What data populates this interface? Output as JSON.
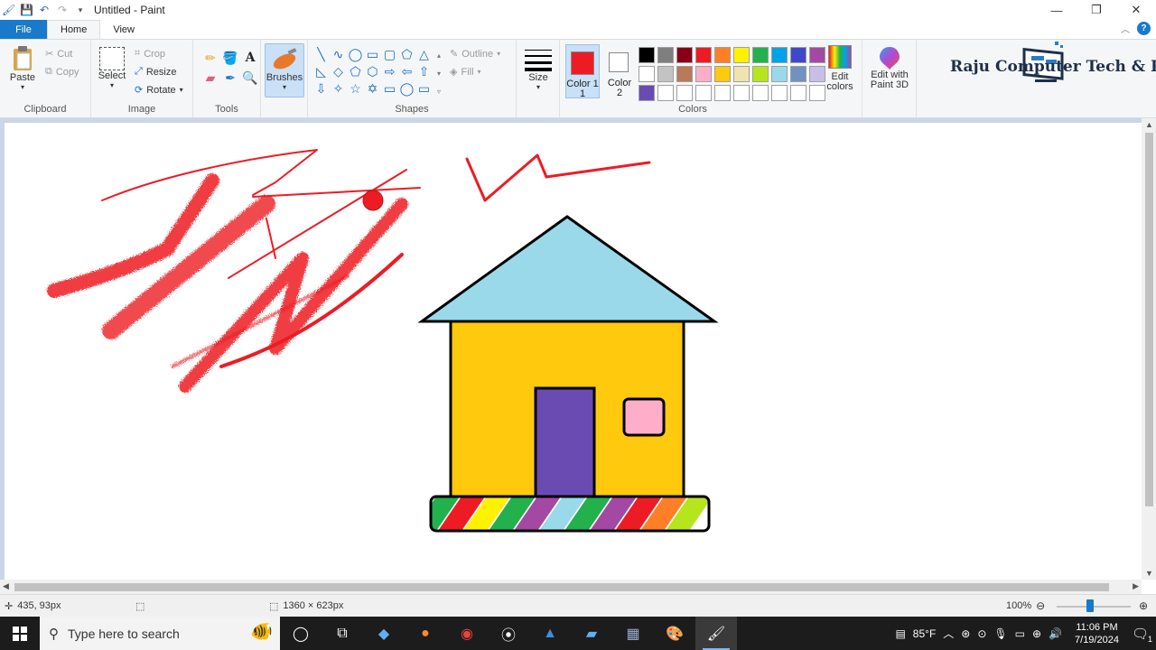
{
  "window": {
    "title": "Untitled - Paint",
    "controls": [
      "minimize",
      "restore",
      "close"
    ]
  },
  "ribbon_tabs": [
    "File",
    "Home",
    "View"
  ],
  "clipboard": {
    "paste": "Paste",
    "cut": "Cut",
    "copy": "Copy",
    "label": "Clipboard"
  },
  "image": {
    "select": "Select",
    "crop": "Crop",
    "resize": "Resize",
    "rotate": "Rotate",
    "label": "Image"
  },
  "tools": {
    "label": "Tools",
    "items": [
      "pencil-icon",
      "fill-icon",
      "text-icon",
      "eraser-icon",
      "color-picker-icon",
      "magnifier-icon"
    ]
  },
  "brushes": {
    "label": "Brushes"
  },
  "shapes": {
    "label": "Shapes",
    "outline": "Outline",
    "fill": "Fill",
    "glyphs": [
      "╲",
      "∿",
      "◯",
      "▭",
      "▢",
      "⬠",
      "△",
      "◺",
      "◇",
      "⬠",
      "⬡",
      "⇨",
      "⇦",
      "⇧",
      "⇩",
      "✧",
      "☆",
      "✡",
      "▭",
      "◯",
      "▭"
    ]
  },
  "size": {
    "label": "Size"
  },
  "colors": {
    "label": "Colors",
    "color1_label": "Color 1",
    "color1_num": "1",
    "color2_label": "Color",
    "color2_num": "2",
    "color1": "#ed1c24",
    "color2": "#ffffff",
    "edit_colors": "Edit colors",
    "edit_with": "Edit with",
    "paint3d": "Paint 3D",
    "palette": [
      "#000000",
      "#7f7f7f",
      "#880015",
      "#ed1c24",
      "#ff7f27",
      "#fff200",
      "#22b14c",
      "#00a2e8",
      "#3f48cc",
      "#a349a4",
      "#ffffff",
      "#c3c3c3",
      "#b97a57",
      "#ffaec9",
      "#ffc90e",
      "#efe4b0",
      "#b5e61d",
      "#99d9ea",
      "#7092be",
      "#c8bfe7",
      "#6a4bb1",
      "#ffffff",
      "#ffffff",
      "#ffffff",
      "#ffffff",
      "#ffffff",
      "#ffffff",
      "#ffffff",
      "#ffffff",
      "#ffffff"
    ]
  },
  "branding": {
    "text": "Raju Computer Tech & It"
  },
  "status": {
    "cursor_pos": "435, 93px",
    "canvas_size": "1360 × 623px",
    "zoom": "100%",
    "zoom_fraction": 0.45
  },
  "taskbar": {
    "search_placeholder": "Type here to search",
    "weather": "85°F",
    "time": "11:06 PM",
    "date": "7/19/2024",
    "notifications": "1"
  },
  "drawing": {
    "house": {
      "roof_color": "#99d9ea",
      "wall_color": "#ffc90e",
      "door_color": "#6a4bb1",
      "window_color": "#ffaec9",
      "base_stripes": [
        "#22b14c",
        "#ed1c24",
        "#fff200",
        "#22b14c",
        "#a349a4",
        "#99d9ea",
        "#22b14c",
        "#a349a4",
        "#ed1c24",
        "#ff7f27",
        "#b5e61d"
      ]
    },
    "scribble_color": "#ed1c24"
  }
}
